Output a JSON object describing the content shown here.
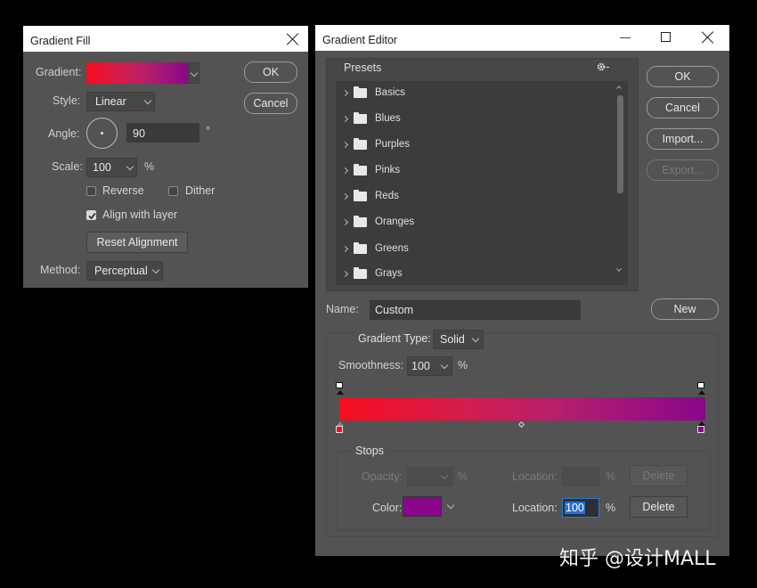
{
  "gradient_fill": {
    "title": "Gradient Fill",
    "gradient_label": "Gradient:",
    "style_label": "Style:",
    "style_value": "Linear",
    "angle_label": "Angle:",
    "angle_value": "90",
    "angle_unit": "°",
    "scale_label": "Scale:",
    "scale_value": "100",
    "scale_unit": "%",
    "reverse_label": "Reverse",
    "reverse_checked": false,
    "dither_label": "Dither",
    "dither_checked": false,
    "align_label": "Align with layer",
    "align_checked": true,
    "reset_label": "Reset Alignment",
    "method_label": "Method:",
    "method_value": "Perceptual",
    "ok_label": "OK",
    "cancel_label": "Cancel"
  },
  "gradient_editor": {
    "title": "Gradient Editor",
    "presets_label": "Presets",
    "gear_icon": "gear-icon",
    "presets": [
      "Basics",
      "Blues",
      "Purples",
      "Pinks",
      "Reds",
      "Oranges",
      "Greens",
      "Grays"
    ],
    "ok_label": "OK",
    "cancel_label": "Cancel",
    "import_label": "Import...",
    "export_label": "Export...",
    "name_label": "Name:",
    "name_value": "Custom",
    "new_label": "New",
    "type_label": "Gradient Type:",
    "type_value": "Solid",
    "smoothness_label": "Smoothness:",
    "smoothness_value": "100",
    "smoothness_unit": "%",
    "stops_label": "Stops",
    "opacity_label": "Opacity:",
    "opacity_unit": "%",
    "location_label": "Location:",
    "location_unit": "%",
    "delete_label": "Delete",
    "color_label": "Color:",
    "color_location_value": "100",
    "stop_colors": [
      "#f70d20",
      "#8a068c"
    ],
    "selected_color": "#8a068c"
  },
  "watermark": "知乎 @设计MALL"
}
